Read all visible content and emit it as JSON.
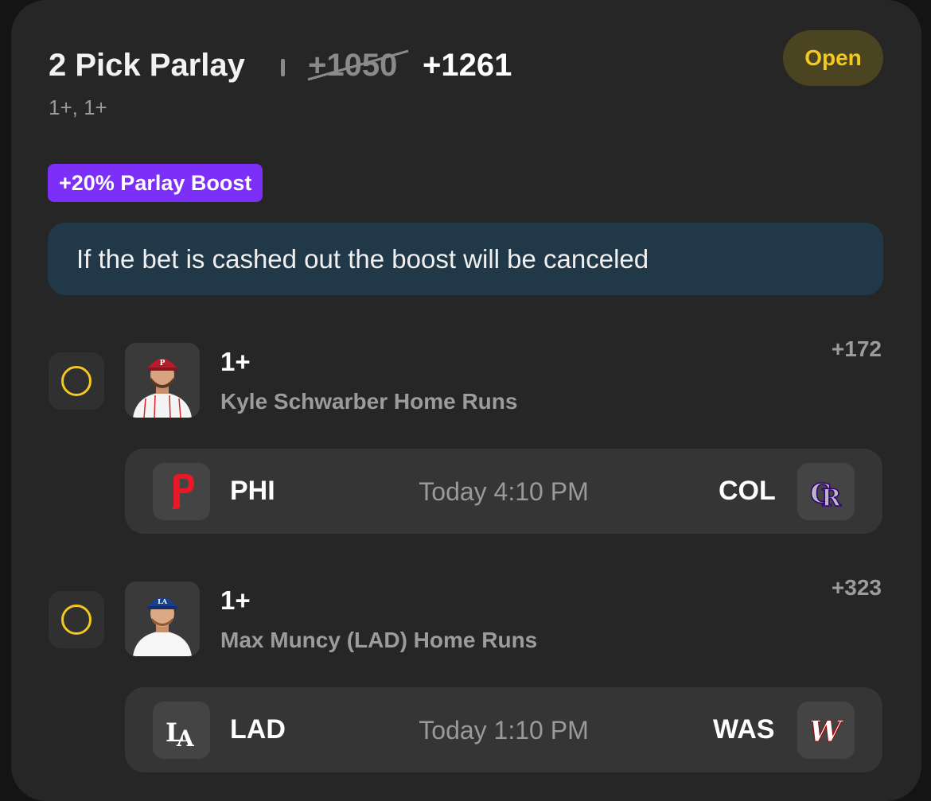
{
  "bet": {
    "title": "2 Pick Parlay",
    "original_odds": "+1050",
    "boosted_odds": "+1261",
    "subtitle": "1+, 1+",
    "status": "Open",
    "boost_label": "+20% Parlay Boost",
    "notice": "If the bet is cashed out the boost will be canceled"
  },
  "legs": [
    {
      "line": "1+",
      "market": "Kyle Schwarber Home Runs",
      "odds": "+172",
      "game": {
        "home": {
          "abbr": "PHI",
          "logo_icon": "phillies-logo-icon",
          "color": "#e81828"
        },
        "away": {
          "abbr": "COL",
          "logo_icon": "rockies-logo-icon",
          "color": "#33006f"
        },
        "time": "Today 4:10 PM"
      }
    },
    {
      "line": "1+",
      "market": "Max Muncy (LAD) Home Runs",
      "odds": "+323",
      "game": {
        "home": {
          "abbr": "LAD",
          "logo_icon": "dodgers-logo-icon",
          "color": "#1b3f8f"
        },
        "away": {
          "abbr": "WAS",
          "logo_icon": "nationals-logo-icon",
          "color": "#ab0003"
        },
        "time": "Today 1:10 PM"
      }
    }
  ],
  "colors": {
    "accent_yellow": "#f4c81f",
    "boost_purple": "#7b2ff7",
    "notice_bg": "#213848"
  }
}
